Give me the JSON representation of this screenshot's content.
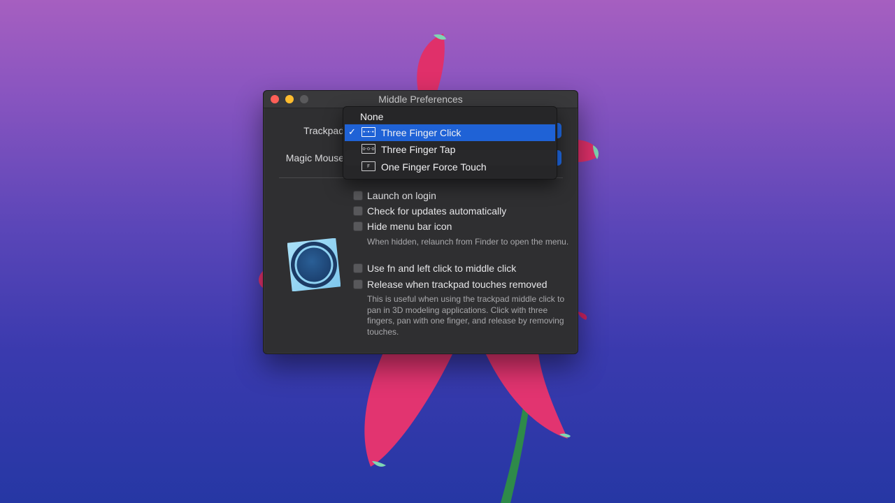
{
  "window": {
    "title": "Middle Preferences"
  },
  "settings": {
    "trackpad_label": "Trackpad",
    "magic_mouse_label": "Magic Mouse"
  },
  "dropdown": {
    "items": [
      {
        "label": "None",
        "icon": "",
        "checked": false,
        "selected": false
      },
      {
        "label": "Three Finger Click",
        "icon": "three-finger-click-icon",
        "checked": true,
        "selected": true
      },
      {
        "label": "Three Finger Tap",
        "icon": "three-finger-tap-icon",
        "checked": false,
        "selected": false
      },
      {
        "label": "One Finger Force Touch",
        "icon": "force-touch-icon",
        "checked": false,
        "selected": false
      }
    ],
    "check_mark": "✓"
  },
  "options": {
    "launch_on_login": "Launch on login",
    "check_updates": "Check for updates automatically",
    "hide_menu_bar_icon": "Hide menu bar icon",
    "hide_help": "When hidden, relaunch from Finder to open the menu.",
    "fn_left_click": "Use fn and left click to middle click",
    "release_touches": "Release when trackpad touches removed",
    "release_help": "This is useful when using the trackpad middle click to pan in 3D modeling applications. Click with three fingers, pan with one finger, and release by removing touches."
  },
  "colors": {
    "accent": "#1f62d6",
    "close": "#ff5f57",
    "minimize": "#febc2e"
  }
}
